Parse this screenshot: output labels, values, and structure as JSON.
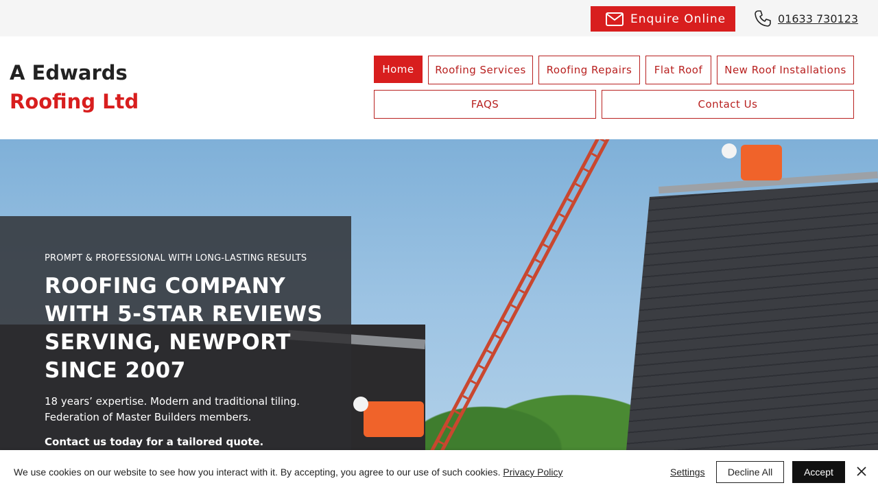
{
  "topbar": {
    "enquire_label": "Enquire Online",
    "phone_number": "01633 730123"
  },
  "logo": {
    "line1": "A Edwards",
    "line2": "Roofing Ltd"
  },
  "nav": {
    "items": [
      {
        "label": "Home",
        "active": true
      },
      {
        "label": "Roofing Services"
      },
      {
        "label": "Roofing Repairs"
      },
      {
        "label": "Flat Roof"
      },
      {
        "label": "New Roof Installations"
      },
      {
        "label": "FAQS"
      },
      {
        "label": "Contact Us"
      }
    ]
  },
  "hero": {
    "kicker": "PROMPT & PROFESSIONAL WITH LONG-LASTING RESULTS",
    "title": "ROOFING COMPANY WITH 5-STAR REVIEWS SERVING, NEWPORT SINCE 2007",
    "subtitle": "18 years’ expertise. Modern and traditional tiling. Federation of Master Builders members.",
    "cta": "Contact us today for a tailored quote."
  },
  "cookie": {
    "message": "We use cookies on our website to see how you interact with it. By accepting, you agree to our use of such cookies.",
    "policy_link": "Privacy Policy",
    "settings_label": "Settings",
    "decline_label": "Decline All",
    "accept_label": "Accept"
  },
  "colors": {
    "brand_red": "#d81e1e",
    "nav_border": "#b8201f",
    "dark_panel": "#2d2d30"
  },
  "icons": {
    "enquire": "envelope-icon",
    "phone": "phone-icon",
    "close": "close-icon"
  }
}
